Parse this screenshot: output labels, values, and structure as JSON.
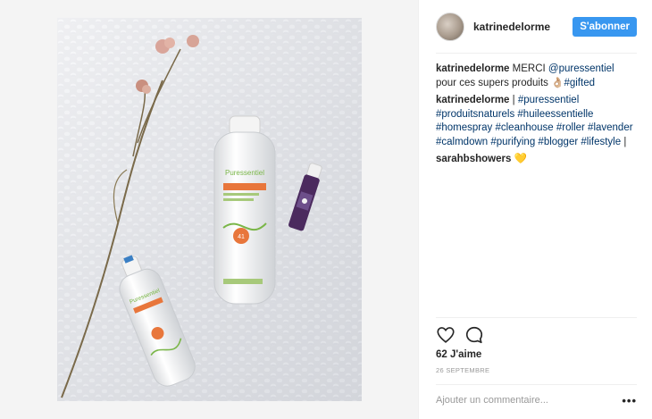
{
  "post": {
    "username": "katrinedelorme",
    "follow_label": "S'abonner",
    "likes": "62 J'aime",
    "date": "26 SEPTEMBRE",
    "comment_placeholder": "Ajouter un commentaire...",
    "more_label": "•••"
  },
  "caption": {
    "user": "katrinedelorme",
    "text_1": " MERCI ",
    "mention": "@puressentiel",
    "text_2": " pour ces supers produits ",
    "emoji": "👌🏼",
    "hashtag": "#gifted"
  },
  "comment1": {
    "user": "katrinedelorme",
    "sep": " | ",
    "tags_1": "#puressentiel",
    "tags_2": "#produitsnaturels #huileessentielle #homespray #cleanhouse #roller #lavender #calmdown #purifying #blogger #lifestyle",
    "trail": " |"
  },
  "comment2": {
    "user": "sarahbshowers",
    "emoji": "💛"
  },
  "photo": {
    "brand": "Puressentiel",
    "badge": "41",
    "alt_icons": [
      "flower-icon",
      "spray-bottle-icon",
      "roller-bottle-icon"
    ]
  },
  "colors": {
    "follow": "#3897f0",
    "link": "#003569",
    "accent_orange": "#e8763b",
    "accent_green": "#7ab648",
    "roller_purple": "#4b2a5e"
  }
}
